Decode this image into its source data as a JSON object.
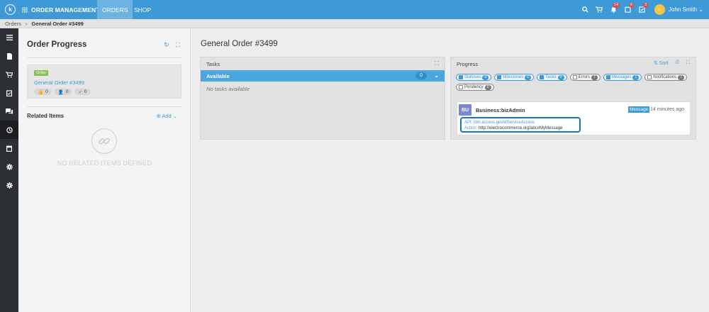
{
  "topbar": {
    "logo": "k",
    "app_title": "ORDER MANAGEMENT",
    "tabs": [
      {
        "label": "ORDERS",
        "active": true
      },
      {
        "label": "SHOP",
        "active": false
      }
    ],
    "icons": [
      {
        "name": "search-icon",
        "glyph": "⚲",
        "badge": ""
      },
      {
        "name": "cart-icon",
        "glyph": "🛒",
        "badge": ""
      },
      {
        "name": "bell-icon",
        "glyph": "🔔",
        "badge": "14"
      },
      {
        "name": "tasks-icon",
        "glyph": "▣",
        "badge": "6"
      },
      {
        "name": "checklist-icon",
        "glyph": "☑",
        "badge": "3"
      }
    ],
    "user": {
      "name": "John Smith",
      "avatar": "☺"
    }
  },
  "breadcrumb": {
    "root": "Orders",
    "current": "General Order #3499"
  },
  "left_panel": {
    "title": "Order Progress",
    "order": {
      "tag": "Order",
      "link": "General Order #3499",
      "pills": [
        {
          "icon": "thumbs-up-icon",
          "glyph": "👍",
          "count": "0"
        },
        {
          "icon": "user-icon",
          "glyph": "👤",
          "count": "0"
        },
        {
          "icon": "check-icon",
          "glyph": "✔",
          "count": "0"
        }
      ]
    },
    "related_title": "Related Items",
    "add_label": "⊕ Add ⌄",
    "empty_text": "NO RELATED ITEMS DEFINED"
  },
  "main": {
    "title": "General Order #3499",
    "tasks": {
      "title": "Tasks",
      "available_label": "Available",
      "available_count": "0",
      "empty_text": "No tasks available"
    },
    "progress": {
      "title": "Progress",
      "sort_label": "⇅ Sort",
      "filters": [
        {
          "label": "Statuses",
          "count": "0",
          "checked": true
        },
        {
          "label": "Milestones",
          "count": "0",
          "checked": true
        },
        {
          "label": "Tasks",
          "count": "0",
          "checked": true
        },
        {
          "label": "Errors",
          "count": "7",
          "checked": false
        },
        {
          "label": "Messages",
          "count": "1",
          "checked": true
        },
        {
          "label": "Notifications",
          "count": "7",
          "checked": false
        },
        {
          "label": "Pendency",
          "count": "0",
          "checked": false
        }
      ],
      "message": {
        "avatar": "BU",
        "user": "Business:bizAdmin",
        "type": "Message",
        "time": "14 minutes ago",
        "api_key": "API:",
        "api_value": "idm.access.getAllServiceAccess",
        "action_key": "Action:",
        "action_value": "http://electrocommerce.org/abc#MyMessage"
      }
    }
  },
  "colors": {
    "accent": "#3d9ad7",
    "sidebar": "#2c2f33",
    "order_tag": "#8cc152",
    "highlight": "#1a73c8"
  }
}
